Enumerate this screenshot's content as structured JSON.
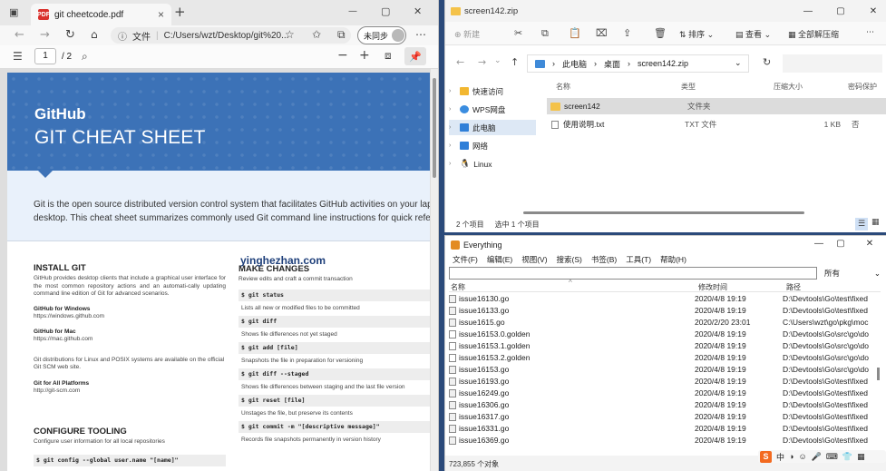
{
  "edge": {
    "tab_title": "git cheetcode.pdf",
    "tab_close": "×",
    "new_tab": "+",
    "address_label": "文件",
    "address": "C:/Users/wzt/Desktop/git%20...",
    "profile_label": "未同步",
    "page_current": "1",
    "page_total": "/ 2",
    "win_min": "—",
    "win_max": "▢",
    "win_close": "✕"
  },
  "pdf": {
    "brand": "GitHub",
    "title": "GIT CHEAT SHEET",
    "intro_line1": "Git is the open source distributed version control system that facilitates GitHub activities on your laptop o",
    "intro_line2": "desktop. This cheat sheet summarizes commonly used Git command line instructions for quick reference.",
    "install": {
      "heading": "INSTALL GIT",
      "text": "GitHub provides desktop clients that include a graphical user interface for the most common repository actions and an automati-cally updating command line edition of Git for advanced scenarios.",
      "win_heading": "GitHub for Windows",
      "win_url": "https://windows.github.com",
      "mac_heading": "GitHub for Mac",
      "mac_url": "https://mac.github.com",
      "linux_text": "Git distributions for Linux and POSIX systems are available on the official Git SCM web site.",
      "all_heading": "Git for All Platforms",
      "all_url": "http://git-scm.com"
    },
    "configure": {
      "heading": "CONFIGURE TOOLING",
      "text": "Configure user information for all local repositories",
      "cmd_partial": "$ git config --global user.name \"[name]\""
    },
    "changes": {
      "heading": "MAKE CHANGES",
      "text": "Review edits and craft a commit transaction",
      "commands": [
        {
          "cmd": "$ git status",
          "desc": "Lists all new or modified files to be committed"
        },
        {
          "cmd": "$ git diff",
          "desc": "Shows file differences not yet staged"
        },
        {
          "cmd": "$ git add [file]",
          "desc": "Snapshots the file in preparation for versioning"
        },
        {
          "cmd": "$ git diff --staged",
          "desc": "Shows file differences between staging and the last file version"
        },
        {
          "cmd": "$ git reset [file]",
          "desc": "Unstages the file, but preserve its contents"
        },
        {
          "cmd": "$ git commit -m \"[descriptive message]\"",
          "desc": "Records file snapshots permanently in version history"
        }
      ]
    }
  },
  "watermark": "yinghezhan.com",
  "explorer": {
    "title": "screen142.zip",
    "cmd_new": "新建",
    "cmd_sort": "排序",
    "cmd_view": "查看",
    "cmd_extract": "全部解压缩",
    "breadcrumb": [
      "此电脑",
      "桌面",
      "screen142.zip"
    ],
    "sidebar": [
      {
        "label": "快速访问",
        "color": "#f2b731"
      },
      {
        "label": "WPS网盘",
        "color": "#3a8de0"
      },
      {
        "label": "此电脑",
        "color": "#2f7fd8"
      },
      {
        "label": "网络",
        "color": "#2f7fd8"
      },
      {
        "label": "Linux",
        "color": "#333333"
      }
    ],
    "columns": [
      "名称",
      "类型",
      "压缩大小",
      "密码保护"
    ],
    "rows": [
      {
        "name": "screen142",
        "type": "文件夹",
        "size": "",
        "protect": ""
      },
      {
        "name": "使用说明.txt",
        "type": "TXT 文件",
        "size": "1 KB",
        "protect": "否"
      }
    ],
    "status_count": "2 个项目",
    "status_selected": "选中 1 个项目"
  },
  "everything": {
    "title": "Everything",
    "menu": [
      "文件(F)",
      "编辑(E)",
      "视图(V)",
      "搜索(S)",
      "书签(B)",
      "工具(T)",
      "帮助(H)"
    ],
    "filter": "所有",
    "columns": [
      "名称",
      "修改时间",
      "路径"
    ],
    "rows": [
      {
        "name": "issue16130.go",
        "time": "2020/4/8 19:19",
        "path": "D:\\Devtools\\Go\\test\\fixed"
      },
      {
        "name": "issue16133.go",
        "time": "2020/4/8 19:19",
        "path": "D:\\Devtools\\Go\\test\\fixed"
      },
      {
        "name": "issue1615.go",
        "time": "2020/2/20 23:01",
        "path": "C:\\Users\\wzt\\go\\pkg\\moc"
      },
      {
        "name": "issue16153.0.golden",
        "time": "2020/4/8 19:19",
        "path": "D:\\Devtools\\Go\\src\\go\\do"
      },
      {
        "name": "issue16153.1.golden",
        "time": "2020/4/8 19:19",
        "path": "D:\\Devtools\\Go\\src\\go\\do"
      },
      {
        "name": "issue16153.2.golden",
        "time": "2020/4/8 19:19",
        "path": "D:\\Devtools\\Go\\src\\go\\do"
      },
      {
        "name": "issue16153.go",
        "time": "2020/4/8 19:19",
        "path": "D:\\Devtools\\Go\\src\\go\\do"
      },
      {
        "name": "issue16193.go",
        "time": "2020/4/8 19:19",
        "path": "D:\\Devtools\\Go\\test\\fixed"
      },
      {
        "name": "issue16249.go",
        "time": "2020/4/8 19:19",
        "path": "D:\\Devtools\\Go\\test\\fixed"
      },
      {
        "name": "issue16306.go",
        "time": "2020/4/8 19:19",
        "path": "D:\\Devtools\\Go\\test\\fixed"
      },
      {
        "name": "issue16317.go",
        "time": "2020/4/8 19:19",
        "path": "D:\\Devtools\\Go\\test\\fixed"
      },
      {
        "name": "issue16331.go",
        "time": "2020/4/8 19:19",
        "path": "D:\\Devtools\\Go\\test\\fixed"
      },
      {
        "name": "issue16369.go",
        "time": "2020/4/8 19:19",
        "path": "D:\\Devtools\\Go\\test\\fixed"
      }
    ],
    "status": "723,855 个对象"
  },
  "ime": {
    "logo": "S",
    "lang": "中"
  },
  "colors": {
    "pdf_blue": "#3c72b7",
    "ime_orange": "#f36a1f"
  }
}
